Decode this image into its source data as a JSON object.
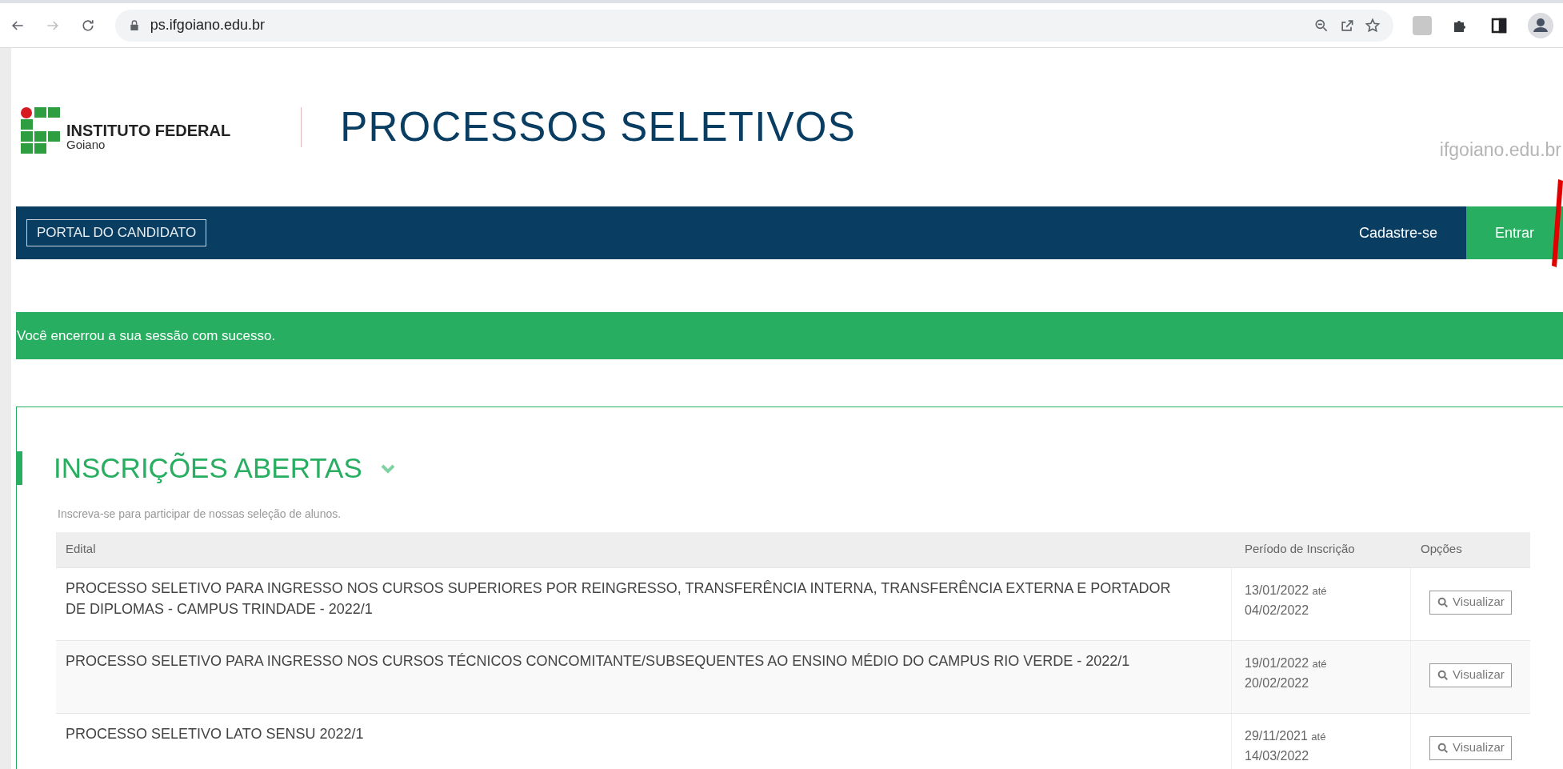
{
  "browser": {
    "url": "ps.ifgoiano.edu.br"
  },
  "header": {
    "logo_title": "INSTITUTO FEDERAL",
    "logo_subtitle": "Goiano",
    "title": "PROCESSOS SELETIVOS",
    "site_link": "ifgoiano.edu.br"
  },
  "navbar": {
    "portal_button": "PORTAL DO CANDIDATO",
    "links": [
      {
        "label": "Cadastre-se",
        "kind": "plain"
      },
      {
        "label": "Entrar",
        "kind": "highlight"
      }
    ]
  },
  "alert": {
    "message": "Você encerrou a sua sessão com sucesso."
  },
  "section": {
    "title": "INSCRIÇÕES ABERTAS",
    "expanded": true,
    "description": "Inscreva-se para participar de nossas seleção de alunos.",
    "table": {
      "columns": [
        "Edital",
        "Período de Inscrição",
        "Opções"
      ],
      "rows": [
        {
          "edital": "PROCESSO SELETIVO PARA INGRESSO NOS CURSOS SUPERIORES POR REINGRESSO, TRANSFERÊNCIA INTERNA, TRANSFERÊNCIA EXTERNA E PORTADOR DE DIPLOMAS - CAMPUS TRINDADE - 2022/1",
          "start": "13/01/2022",
          "until": "até",
          "end": "04/02/2022",
          "action": "Visualizar"
        },
        {
          "edital": "PROCESSO SELETIVO PARA INGRESSO NOS CURSOS TÉCNICOS CONCOMITANTE/SUBSEQUENTES AO ENSINO MÉDIO DO CAMPUS RIO VERDE - 2022/1",
          "start": "19/01/2022",
          "until": "até",
          "end": "20/02/2022",
          "action": "Visualizar"
        },
        {
          "edital": "PROCESSO SELETIVO LATO SENSU 2022/1",
          "start": "29/11/2021",
          "until": "até",
          "end": "14/03/2022",
          "action": "Visualizar"
        }
      ]
    }
  }
}
